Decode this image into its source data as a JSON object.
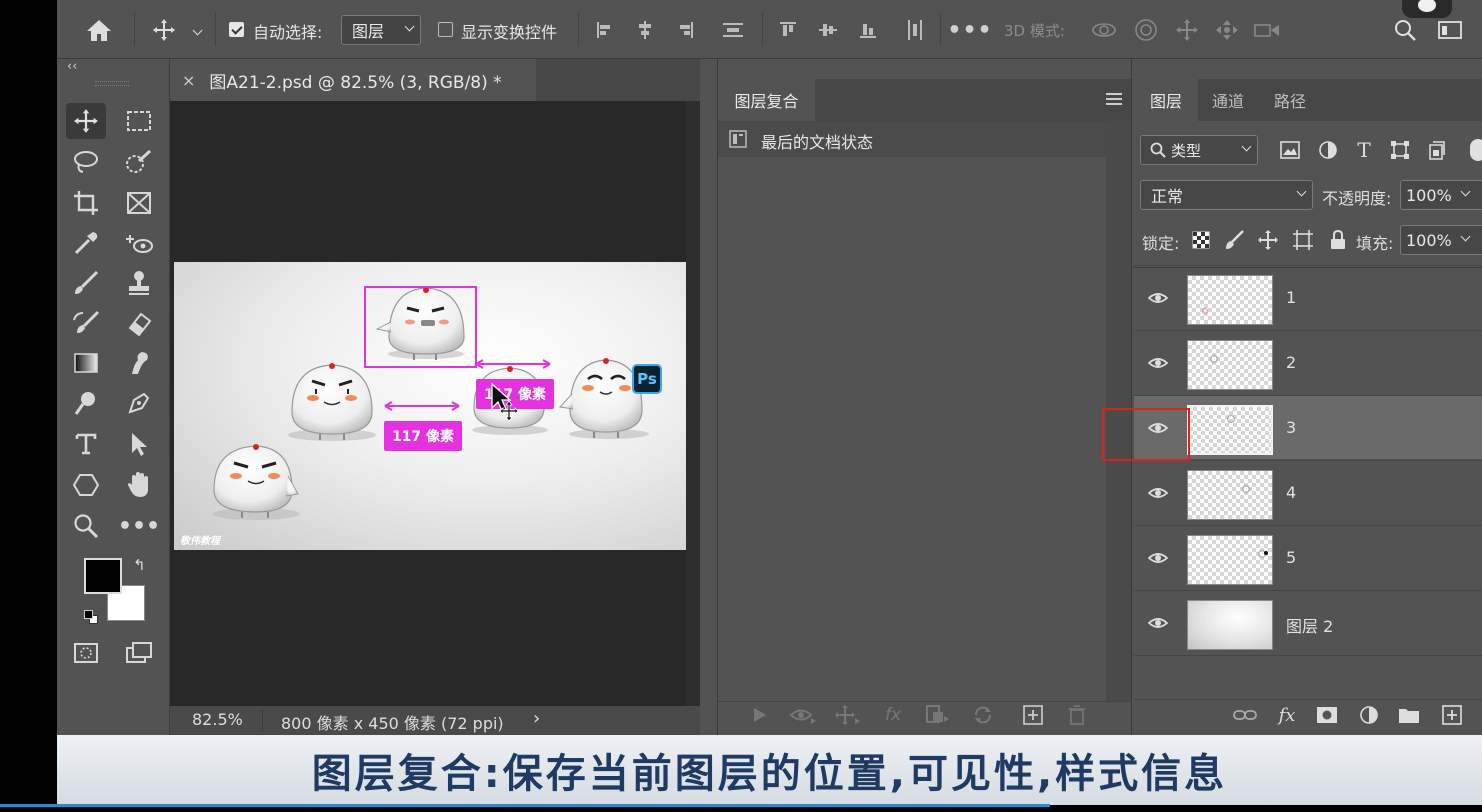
{
  "options_bar": {
    "auto_select_label": "自动选择:",
    "auto_select_checked": true,
    "auto_select_target": "图层",
    "show_transform_label": "显示变换控件",
    "show_transform_checked": false,
    "mode_3d_label": "3D 模式:"
  },
  "document": {
    "tab_title": "图A21-2.psd @ 82.5% (3, RGB/8) *",
    "close_glyph": "×",
    "measure_label_1": "117 像素",
    "measure_label_2": "117 像素",
    "badge": "Ps",
    "watermark": "敬伟教程",
    "zoom": "82.5%",
    "size_info": "800 像素 x 450 像素 (72 ppi)"
  },
  "comps_panel": {
    "tab": "图层复合",
    "item": "最后的文档状态"
  },
  "layers_panel": {
    "tabs": [
      "图层",
      "通道",
      "路径"
    ],
    "filter_kind": "类型",
    "blend_mode": "正常",
    "opacity_label": "不透明度:",
    "opacity_value": "100%",
    "lock_label": "锁定:",
    "fill_label": "填充:",
    "fill_value": "100%",
    "layers": [
      {
        "name": "1",
        "selected": false
      },
      {
        "name": "2",
        "selected": false
      },
      {
        "name": "3",
        "selected": true
      },
      {
        "name": "4",
        "selected": false
      },
      {
        "name": "5",
        "selected": false
      },
      {
        "name": "图层 2",
        "selected": false
      }
    ]
  },
  "caption": "图层复合:保存当前图层的位置,可见性,样式信息",
  "colors": {
    "magenta": "#e532e0",
    "accent_blue": "#1d8fe0",
    "caption_text": "#1f3b63",
    "highlight_red": "#e02020"
  }
}
